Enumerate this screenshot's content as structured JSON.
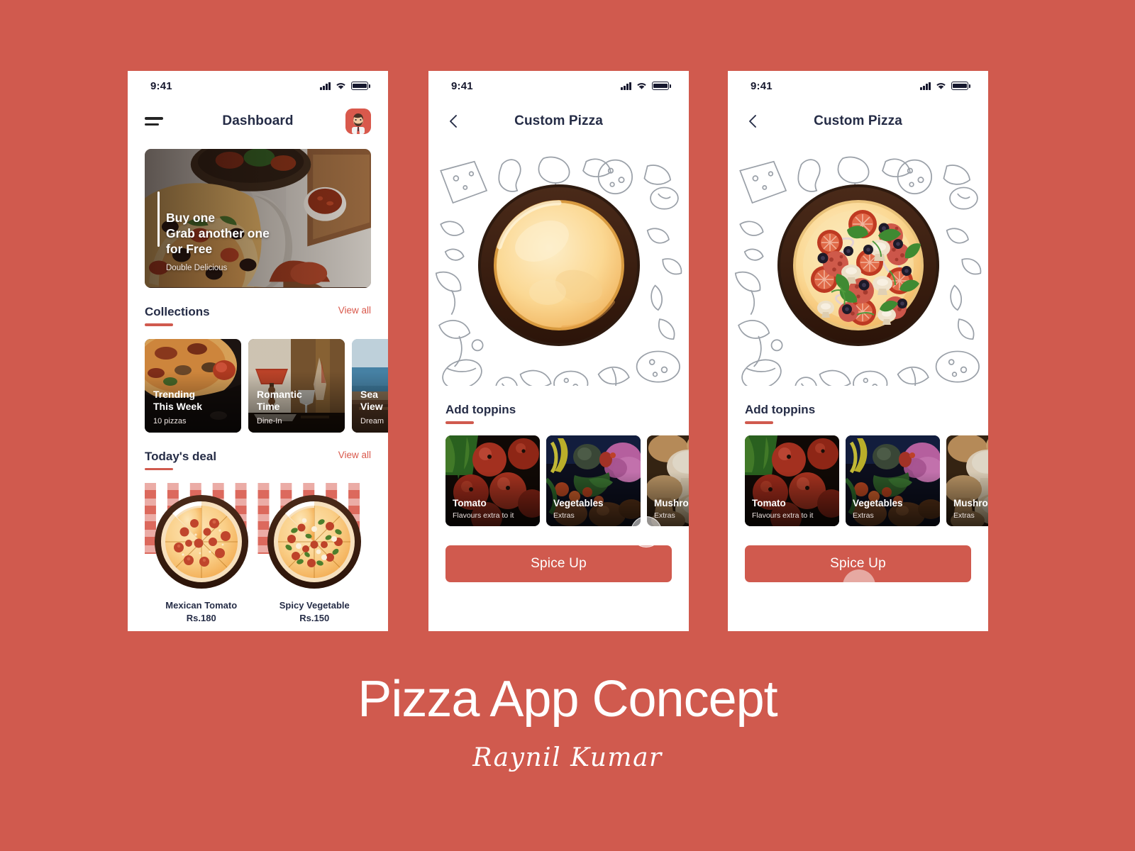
{
  "theme": {
    "background": "#d05a4e",
    "accent": "#d05a4e",
    "text_dark": "#252c46",
    "link": "#d9594c"
  },
  "footer": {
    "title": "Pizza App Concept",
    "author": "Raynil Kumar"
  },
  "screens": [
    {
      "id": "dashboard",
      "status_bar": {
        "time": "9:41",
        "signal_icon": "cellular-signal-icon",
        "wifi_icon": "wifi-icon",
        "battery_icon": "battery-icon"
      },
      "nav": {
        "menu_icon": "hamburger-menu-icon",
        "title": "Dashboard",
        "avatar_icon": "user-avatar"
      },
      "hero": {
        "line1": "Buy one",
        "line2": "Grab another one",
        "line3": "for Free",
        "subtitle": "Double Delicious"
      },
      "collections": {
        "heading": "Collections",
        "view_all": "View all",
        "cards": [
          {
            "name": "Trending\nThis Week",
            "meta": "10 pizzas"
          },
          {
            "name": "Romantic\nTime",
            "meta": "Dine-In"
          },
          {
            "name": "Sea\nView",
            "meta": "Dream"
          }
        ]
      },
      "deal": {
        "heading": "Today's deal",
        "view_all": "View all",
        "items": [
          {
            "name": "Mexican Tomato",
            "price": "Rs.180"
          },
          {
            "name": "Spicy Vegetable",
            "price": "Rs.150"
          }
        ]
      }
    },
    {
      "id": "custom-pizza-plain",
      "status_bar": {
        "time": "9:41",
        "signal_icon": "cellular-signal-icon",
        "wifi_icon": "wifi-icon",
        "battery_icon": "battery-icon"
      },
      "nav": {
        "back_icon": "chevron-left-icon",
        "title": "Custom Pizza"
      },
      "pizza_state": "plain-cheese",
      "toppings": {
        "heading": "Add toppins",
        "cards": [
          {
            "name": "Tomato",
            "meta": "Flavours extra to it"
          },
          {
            "name": "Vegetables",
            "meta": "Extras"
          },
          {
            "name": "Mushroom",
            "meta": "Extras"
          }
        ]
      },
      "cta": "Spice Up"
    },
    {
      "id": "custom-pizza-topped",
      "status_bar": {
        "time": "9:41",
        "signal_icon": "cellular-signal-icon",
        "wifi_icon": "wifi-icon",
        "battery_icon": "battery-icon"
      },
      "nav": {
        "back_icon": "chevron-left-icon",
        "title": "Custom Pizza"
      },
      "pizza_state": "fully-topped",
      "toppings": {
        "heading": "Add toppins",
        "cards": [
          {
            "name": "Tomato",
            "meta": "Flavours extra to it"
          },
          {
            "name": "Vegetables",
            "meta": "Extras"
          },
          {
            "name": "Mushroom",
            "meta": "Extras"
          }
        ]
      },
      "cta": "Spice Up"
    }
  ]
}
